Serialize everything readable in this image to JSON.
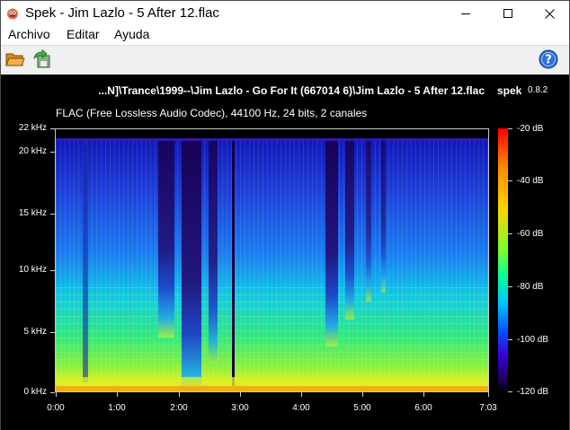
{
  "window": {
    "title": "Spek - Jim Lazlo - 5 After 12.flac",
    "icons": {
      "app": "spek-app-icon",
      "minimize": "minimize-icon",
      "maximize": "maximize-icon",
      "close": "close-icon"
    }
  },
  "menu": {
    "items": [
      {
        "label": "Archivo"
      },
      {
        "label": "Editar"
      },
      {
        "label": "Ayuda"
      }
    ]
  },
  "toolbar": {
    "open_icon": "folder-open-icon",
    "save_icon": "save-arrow-icon",
    "help_icon": "help-icon"
  },
  "spectrogram": {
    "file_title": "...N]\\Trance\\1999--\\Jim Lazlo - Go For It (667014 6)\\Jim Lazlo - 5 After 12.flac",
    "app_name": "spek",
    "version": "0.8.2",
    "codec_info": "FLAC (Free Lossless Audio Codec), 44100 Hz, 24 bits, 2 canales",
    "y_labels": [
      {
        "text": "22 kHz"
      },
      {
        "text": "20 kHz"
      },
      {
        "text": "15 kHz"
      },
      {
        "text": "10 kHz"
      },
      {
        "text": "5 kHz"
      },
      {
        "text": "0 kHz"
      }
    ],
    "x_labels": [
      {
        "text": "0:00"
      },
      {
        "text": "1:00"
      },
      {
        "text": "2:00"
      },
      {
        "text": "3:00"
      },
      {
        "text": "4:00"
      },
      {
        "text": "5:00"
      },
      {
        "text": "6:00"
      },
      {
        "text": "7:03"
      }
    ],
    "colorbar_labels": [
      {
        "text": "-20 dB"
      },
      {
        "text": "-40 dB"
      },
      {
        "text": "-60 dB"
      },
      {
        "text": "-80 dB"
      },
      {
        "text": "-100 dB"
      },
      {
        "text": "-120 dB"
      }
    ],
    "frequency_range_khz": [
      0,
      22.05
    ],
    "duration": "7:03",
    "db_range": [
      -120,
      -20
    ]
  }
}
